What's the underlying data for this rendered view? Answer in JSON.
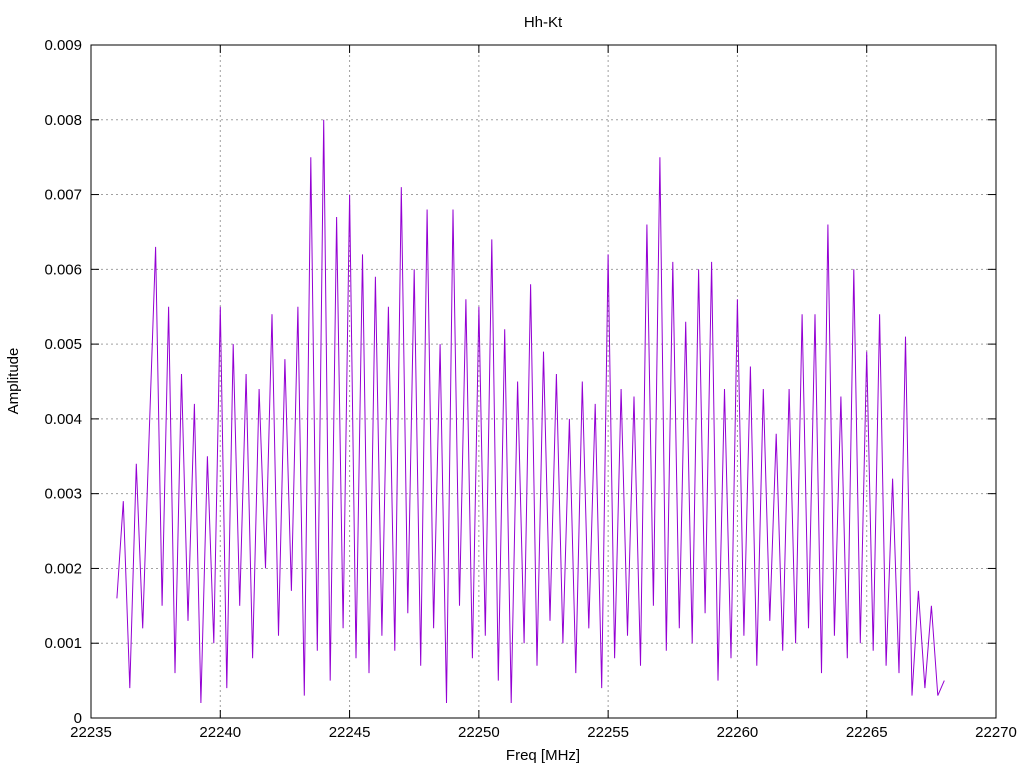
{
  "chart_data": {
    "type": "line",
    "title": "Hh-Kt",
    "xlabel": "Freq [MHz]",
    "ylabel": "Amplitude",
    "xlim": [
      22235,
      22270
    ],
    "ylim": [
      0,
      0.009
    ],
    "xticks": [
      "22235",
      "22240",
      "22245",
      "22250",
      "22255",
      "22260",
      "22265",
      "22270"
    ],
    "yticks": [
      "0",
      "0.001",
      "0.002",
      "0.003",
      "0.004",
      "0.005",
      "0.006",
      "0.007",
      "0.008",
      "0.009"
    ],
    "grid": true,
    "series": [
      {
        "name": "Hh-Kt",
        "color": "#9400d3",
        "x_start": 22236,
        "x_step": 0.25,
        "values": [
          0.0016,
          0.0029,
          0.0004,
          0.0034,
          0.0012,
          0.0038,
          0.0063,
          0.0015,
          0.0055,
          0.0006,
          0.0046,
          0.0013,
          0.0042,
          0.0002,
          0.0035,
          0.001,
          0.0055,
          0.0004,
          0.005,
          0.0015,
          0.0046,
          0.0008,
          0.0044,
          0.002,
          0.0054,
          0.0011,
          0.0048,
          0.0017,
          0.0055,
          0.0003,
          0.0075,
          0.0009,
          0.008,
          0.0005,
          0.0067,
          0.0012,
          0.007,
          0.0008,
          0.0062,
          0.0006,
          0.0059,
          0.0011,
          0.0055,
          0.0009,
          0.0071,
          0.0014,
          0.006,
          0.0007,
          0.0068,
          0.0012,
          0.005,
          0.0002,
          0.0068,
          0.0015,
          0.0056,
          0.0008,
          0.0055,
          0.0011,
          0.0064,
          0.0005,
          0.0052,
          0.0002,
          0.0045,
          0.001,
          0.0058,
          0.0007,
          0.0049,
          0.0013,
          0.0046,
          0.001,
          0.004,
          0.0006,
          0.0045,
          0.0012,
          0.0042,
          0.0004,
          0.0062,
          0.0008,
          0.0044,
          0.0011,
          0.0043,
          0.0007,
          0.0066,
          0.0015,
          0.0075,
          0.0009,
          0.0061,
          0.0012,
          0.0053,
          0.001,
          0.006,
          0.0014,
          0.0061,
          0.0005,
          0.0044,
          0.0008,
          0.0056,
          0.0011,
          0.0047,
          0.0007,
          0.0044,
          0.0013,
          0.0038,
          0.0009,
          0.0044,
          0.001,
          0.0054,
          0.0012,
          0.0054,
          0.0006,
          0.0066,
          0.0011,
          0.0043,
          0.0008,
          0.006,
          0.001,
          0.0049,
          0.0009,
          0.0054,
          0.0007,
          0.0032,
          0.0006,
          0.0051,
          0.0003,
          0.0017,
          0.0004,
          0.0015,
          0.0003,
          0.0005
        ]
      }
    ]
  }
}
